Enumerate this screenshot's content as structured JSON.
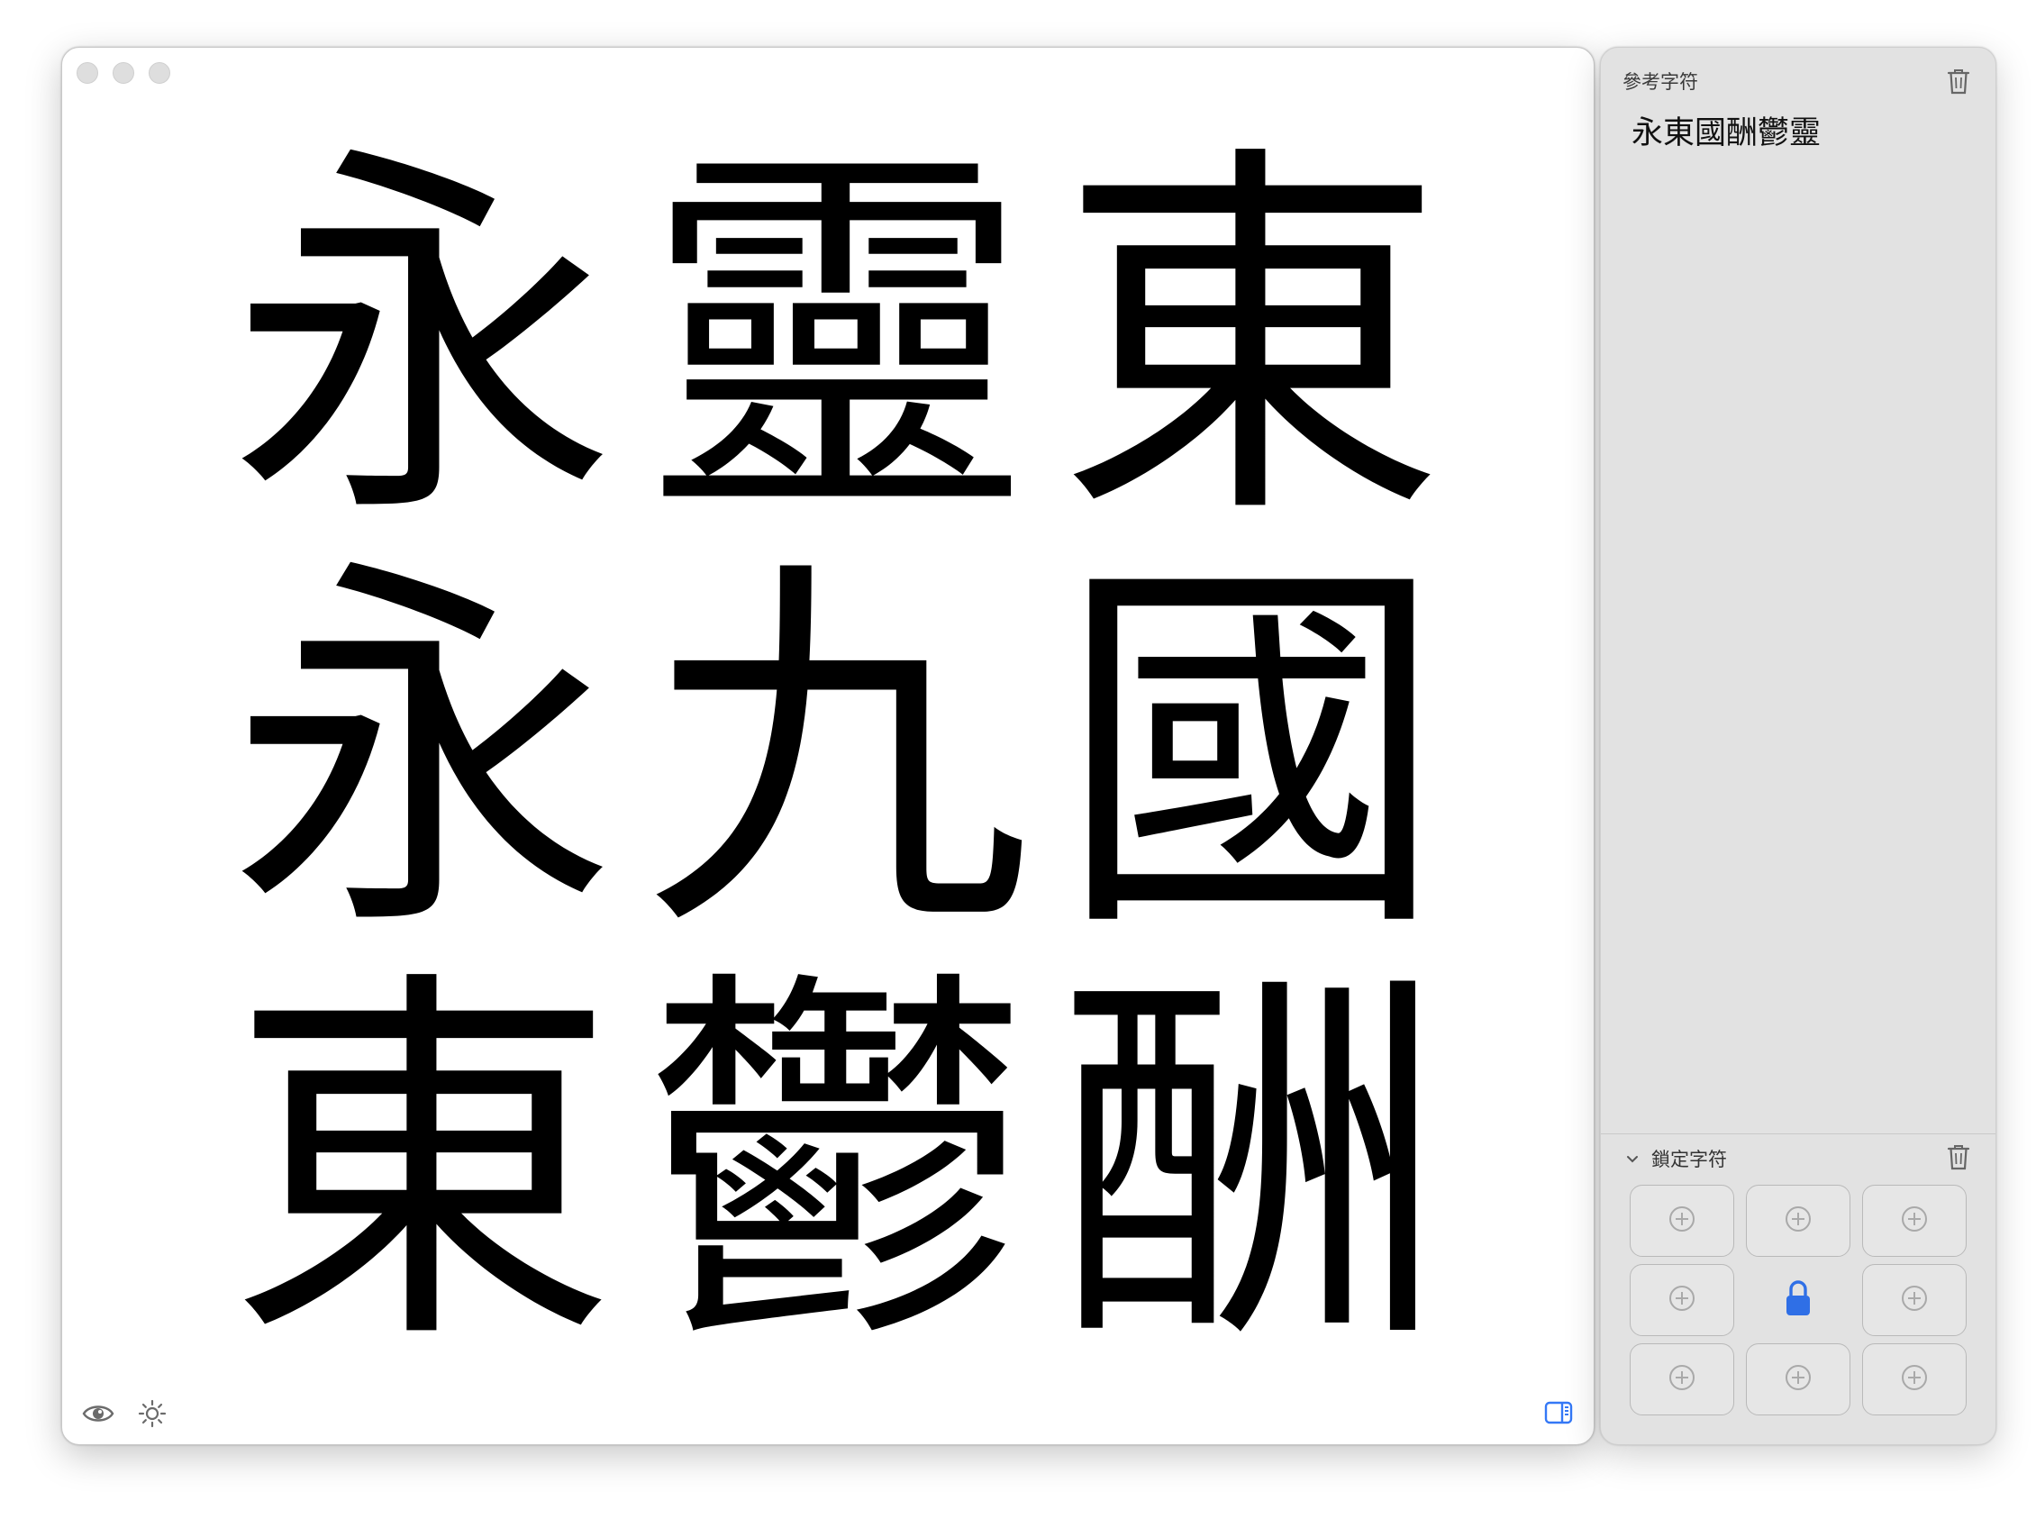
{
  "glyph_grid": [
    [
      "永",
      "靈",
      "東"
    ],
    [
      "永",
      "九",
      "國"
    ],
    [
      "東",
      "鬱",
      "酬"
    ]
  ],
  "toolbar": {
    "icons": [
      "eye-icon",
      "sun-icon"
    ],
    "sidebar_toggle_icon": "sidebar-toggle-icon",
    "accent_color": "#3478f6"
  },
  "reference_panel": {
    "title": "參考字符",
    "characters": "永東國酬鬱靈",
    "trash_icon": "trash-icon"
  },
  "locked_section": {
    "title": "鎖定字符",
    "chevron_icon": "chevron-down-icon",
    "trash_icon": "trash-icon",
    "slots": [
      "add",
      "add",
      "add",
      "add",
      "locked",
      "add",
      "add",
      "add",
      "add"
    ],
    "lock_color": "#2f6fe6"
  }
}
